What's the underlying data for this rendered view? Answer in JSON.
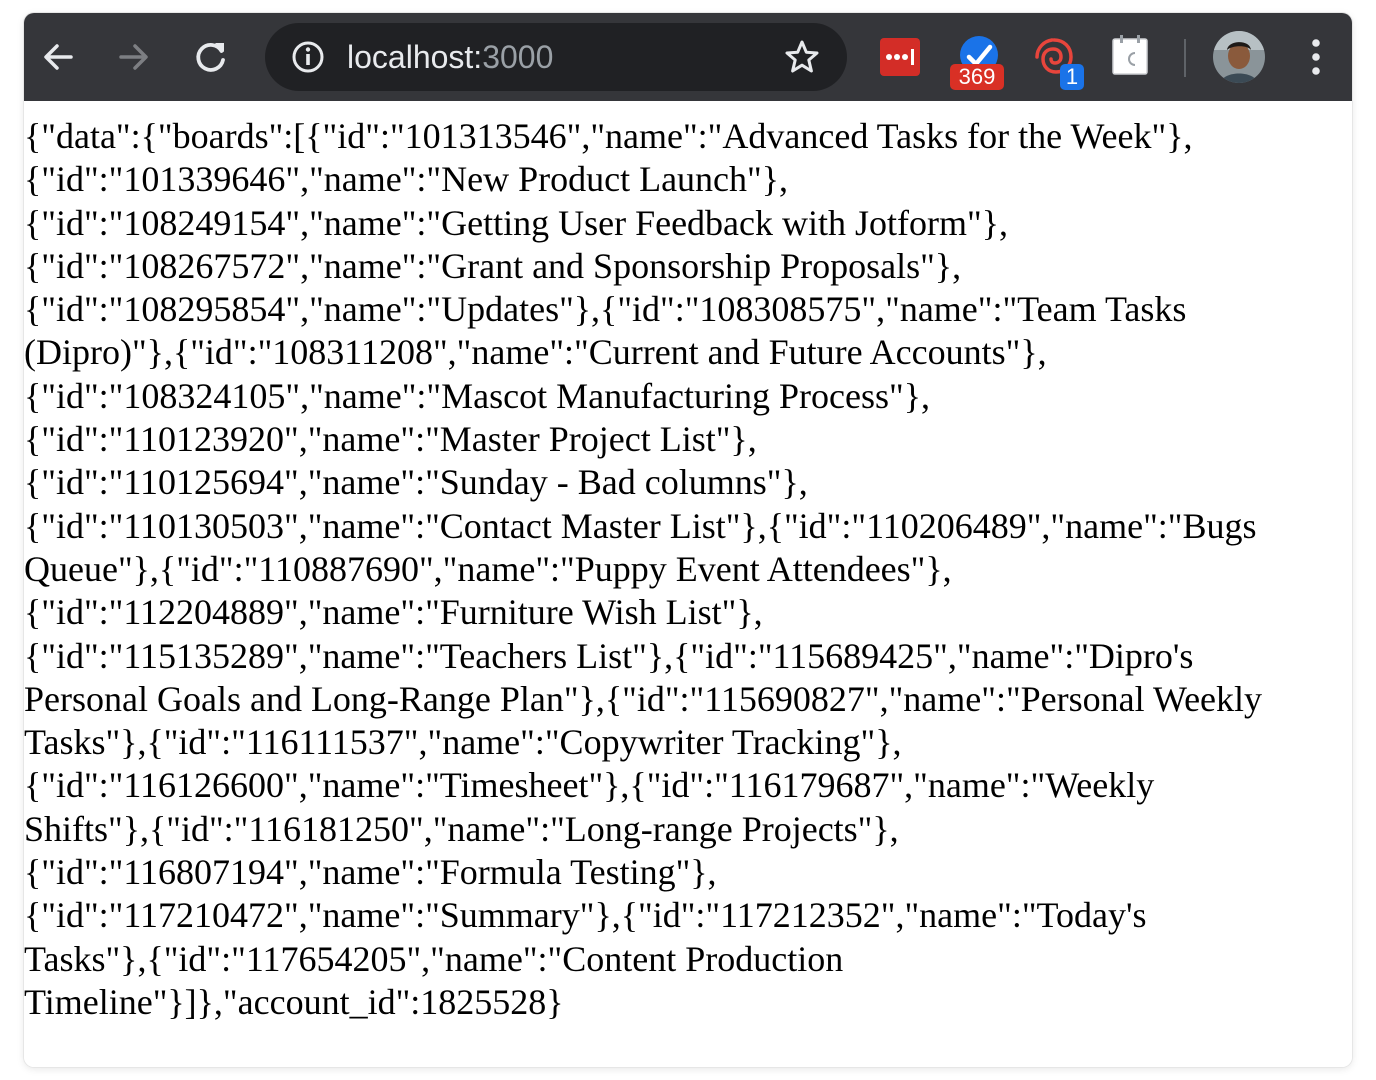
{
  "browser": {
    "url_host": "localhost:",
    "url_port": "3000",
    "back_label": "Back",
    "forward_label": "Forward",
    "reload_label": "Reload",
    "extensions": [
      {
        "icon": "lastpass-icon",
        "badge": ""
      },
      {
        "icon": "checkmark-extension-icon",
        "badge": "369"
      },
      {
        "icon": "spiral-extension-icon",
        "badge": "1"
      },
      {
        "icon": "calendar-extension-icon",
        "badge": ""
      }
    ],
    "accent_colors": {
      "toolbar": "#35363a",
      "omnibox": "#202124",
      "lastpass": "#d32d27",
      "badge_red": "#d93025",
      "badge_blue": "#1a73e8"
    }
  },
  "page": {
    "lines": [
      "{\"data\":{\"boards\":[{\"id\":\"101313546\",\"name\":\"Advanced Tasks for the Week\"},",
      "{\"id\":\"101339646\",\"name\":\"New Product Launch\"},",
      "{\"id\":\"108249154\",\"name\":\"Getting User Feedback with Jotform\"},",
      "{\"id\":\"108267572\",\"name\":\"Grant and Sponsorship Proposals\"},",
      "{\"id\":\"108295854\",\"name\":\"Updates\"},{\"id\":\"108308575\",\"name\":\"Team Tasks",
      "(Dipro)\"},{\"id\":\"108311208\",\"name\":\"Current and Future Accounts\"},",
      "{\"id\":\"108324105\",\"name\":\"Mascot Manufacturing Process\"},",
      "{\"id\":\"110123920\",\"name\":\"Master Project List\"},",
      "{\"id\":\"110125694\",\"name\":\"Sunday - Bad columns\"},",
      "{\"id\":\"110130503\",\"name\":\"Contact Master List\"},{\"id\":\"110206489\",\"name\":\"Bugs",
      "Queue\"},{\"id\":\"110887690\",\"name\":\"Puppy Event Attendees\"},",
      "{\"id\":\"112204889\",\"name\":\"Furniture Wish List\"},",
      "{\"id\":\"115135289\",\"name\":\"Teachers List\"},{\"id\":\"115689425\",\"name\":\"Dipro's",
      "Personal Goals and Long-Range Plan\"},{\"id\":\"115690827\",\"name\":\"Personal Weekly",
      "Tasks\"},{\"id\":\"116111537\",\"name\":\"Copywriter Tracking\"},",
      "{\"id\":\"116126600\",\"name\":\"Timesheet\"},{\"id\":\"116179687\",\"name\":\"Weekly",
      "Shifts\"},{\"id\":\"116181250\",\"name\":\"Long-range Projects\"},",
      "{\"id\":\"116807194\",\"name\":\"Formula Testing\"},",
      "{\"id\":\"117210472\",\"name\":\"Summary\"},{\"id\":\"117212352\",\"name\":\"Today's",
      "Tasks\"},{\"id\":\"117654205\",\"name\":\"Content Production",
      "Timeline\"}]},\"account_id\":1825528}"
    ]
  }
}
